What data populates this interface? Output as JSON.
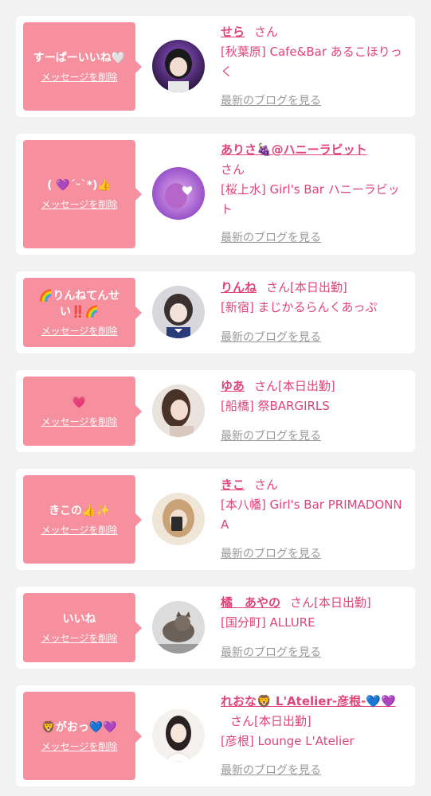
{
  "cards": [
    {
      "message": "すーぱーいいね🤍",
      "delete_label": "メッセージを削除",
      "name": "せら",
      "suffix": "さん",
      "status": "",
      "shop": "[秋葉原] Cafe&Bar あるこほりっく",
      "blog_label": "最新のブログを見る"
    },
    {
      "message": "( 💜ˊᵕˋ*)👍",
      "delete_label": "メッセージを削除",
      "name": "ありさ🍇@ハニーラビット",
      "suffix": "さん",
      "status": "",
      "shop": "[桜上水] Girl's Bar ハニーラビット",
      "blog_label": "最新のブログを見る"
    },
    {
      "message": "🌈りんねてんせい‼️🌈",
      "delete_label": "メッセージを削除",
      "name": "りんね",
      "suffix": "さん",
      "status": "[本日出勤]",
      "shop": "[新宿] まじかるらんくあっぷ",
      "blog_label": "最新のブログを見る"
    },
    {
      "message": "💗",
      "delete_label": "メッセージを削除",
      "name": "ゆあ",
      "suffix": "さん",
      "status": "[本日出勤]",
      "shop": "[船橋] 祭BARGIRLS",
      "blog_label": "最新のブログを見る"
    },
    {
      "message": "きこの👍✨",
      "delete_label": "メッセージを削除",
      "name": "きこ",
      "suffix": "さん",
      "status": "",
      "shop": "[本八幡] Girl's Bar PRIMADONNA",
      "blog_label": "最新のブログを見る"
    },
    {
      "message": "いいね",
      "delete_label": "メッセージを削除",
      "name": "橘　あやの",
      "suffix": "さん",
      "status": "[本日出勤]",
      "shop": "[国分町] ALLURE",
      "blog_label": "最新のブログを見る"
    },
    {
      "message": "🦁がおっ💙💜",
      "delete_label": "メッセージを削除",
      "name": "れおな🦁 L'Atelier-彦根-💙💜",
      "suffix": "さん",
      "status": "[本日出勤]",
      "shop": "[彦根] Lounge L'Atelier",
      "blog_label": "最新のブログを見る"
    }
  ],
  "colors": {
    "message_box": "#f6909e",
    "accent": "#e0447a",
    "blog_link": "#999999",
    "background": "#f2f2f2"
  }
}
